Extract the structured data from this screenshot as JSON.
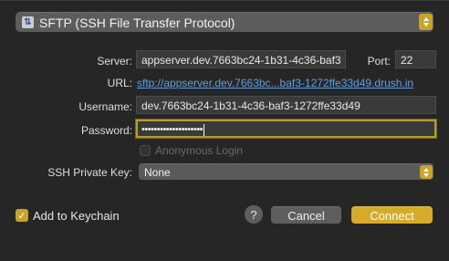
{
  "protocol": {
    "label": "SFTP (SSH File Transfer Protocol)",
    "icon": "sftp-icon"
  },
  "server": {
    "label": "Server:",
    "value": "appserver.dev.7663bc24-1b31-4c36-baf3"
  },
  "port": {
    "label": "Port:",
    "value": "22"
  },
  "url": {
    "label": "URL:",
    "value": "sftp://appserver.dev.7663bc...baf3-1272ffe33d49.drush.in"
  },
  "username": {
    "label": "Username:",
    "value": "dev.7663bc24-1b31-4c36-baf3-1272ffe33d49"
  },
  "password": {
    "label": "Password:",
    "value": "••••••••••••••••••••"
  },
  "anonymous": {
    "label": "Anonymous Login",
    "checked": false
  },
  "ssh_key": {
    "label": "SSH Private Key:",
    "value": "None"
  },
  "keychain": {
    "label": "Add to Keychain",
    "checked": true
  },
  "buttons": {
    "help": "?",
    "cancel": "Cancel",
    "connect": "Connect"
  },
  "colors": {
    "accent": "#d6ab2c",
    "link": "#5aa0e8",
    "background": "#262626"
  }
}
